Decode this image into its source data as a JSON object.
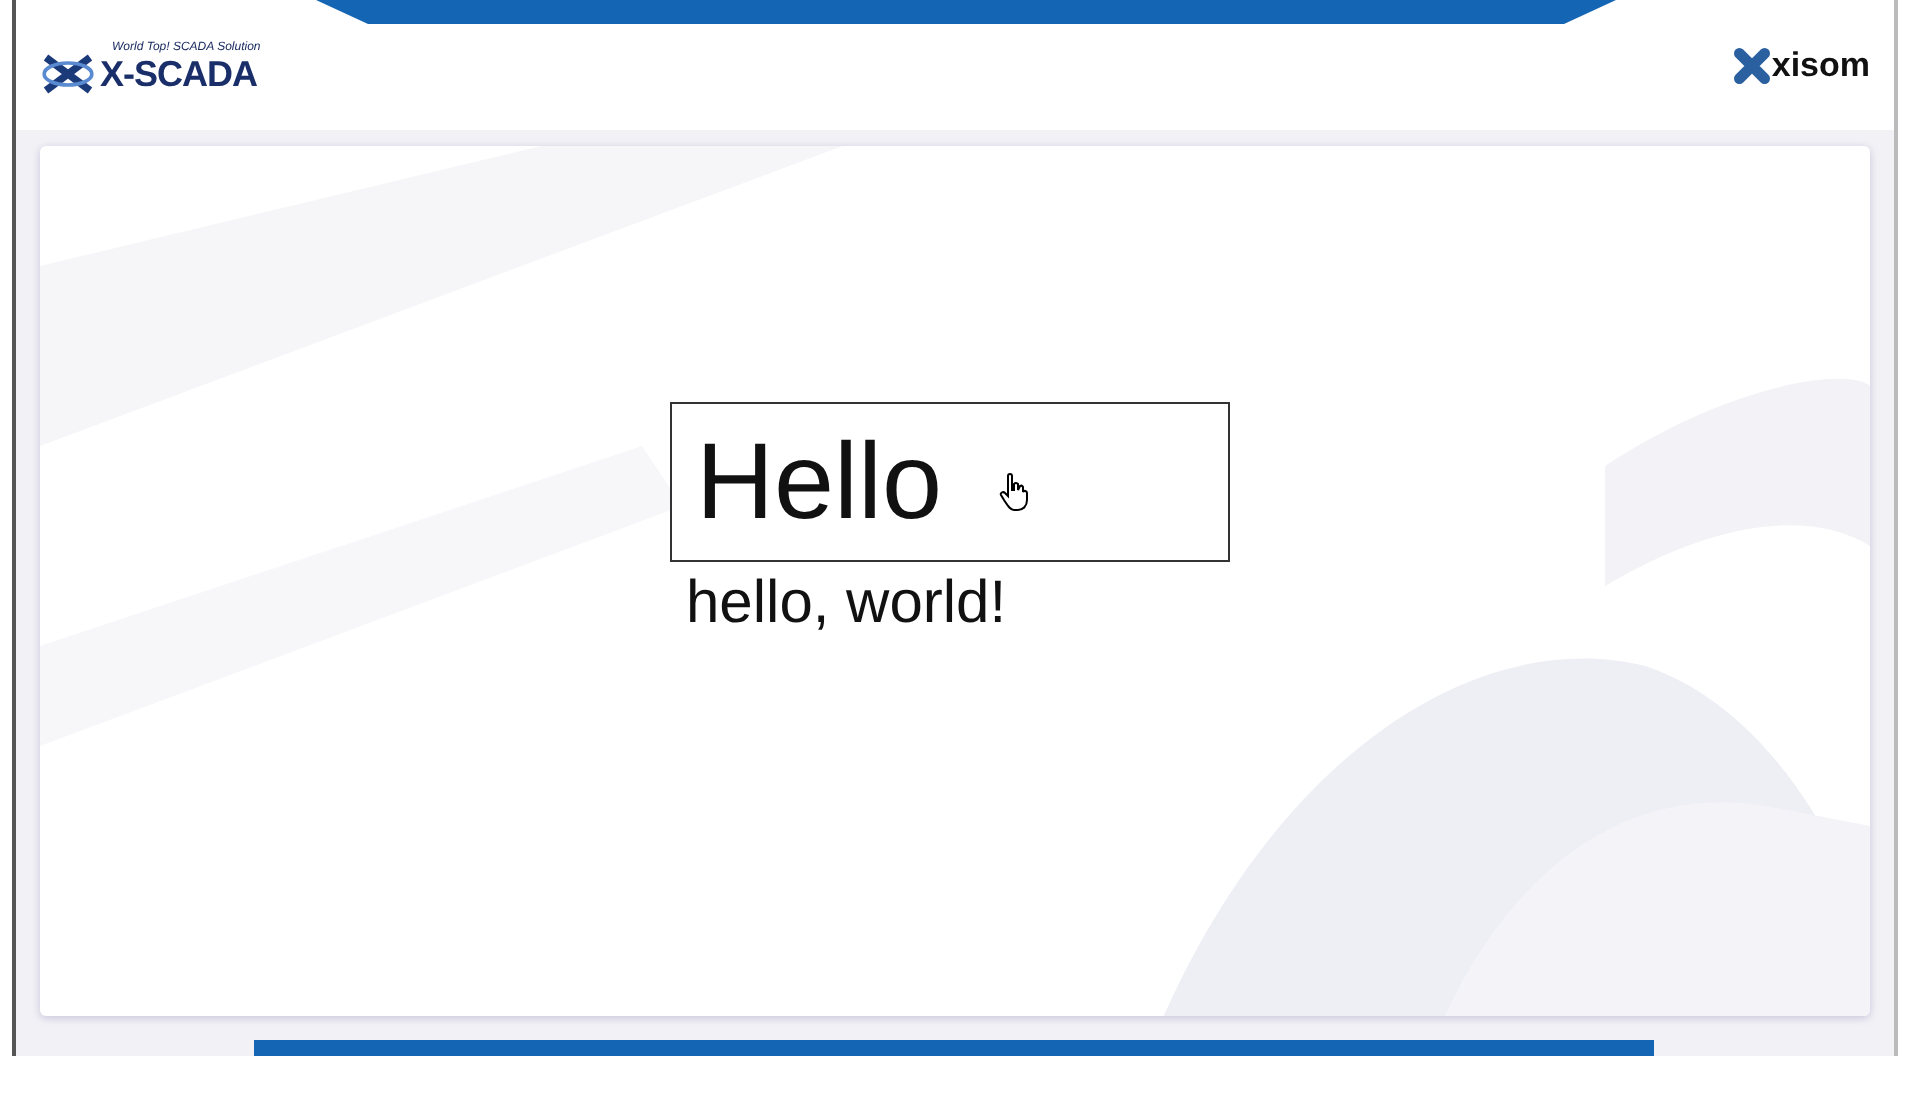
{
  "header": {
    "tagline": "World Top! SCADA Solution",
    "logo": "X-SCADA",
    "brand": "xisom"
  },
  "panel": {
    "title": "Hello",
    "message": "hello, world!"
  }
}
